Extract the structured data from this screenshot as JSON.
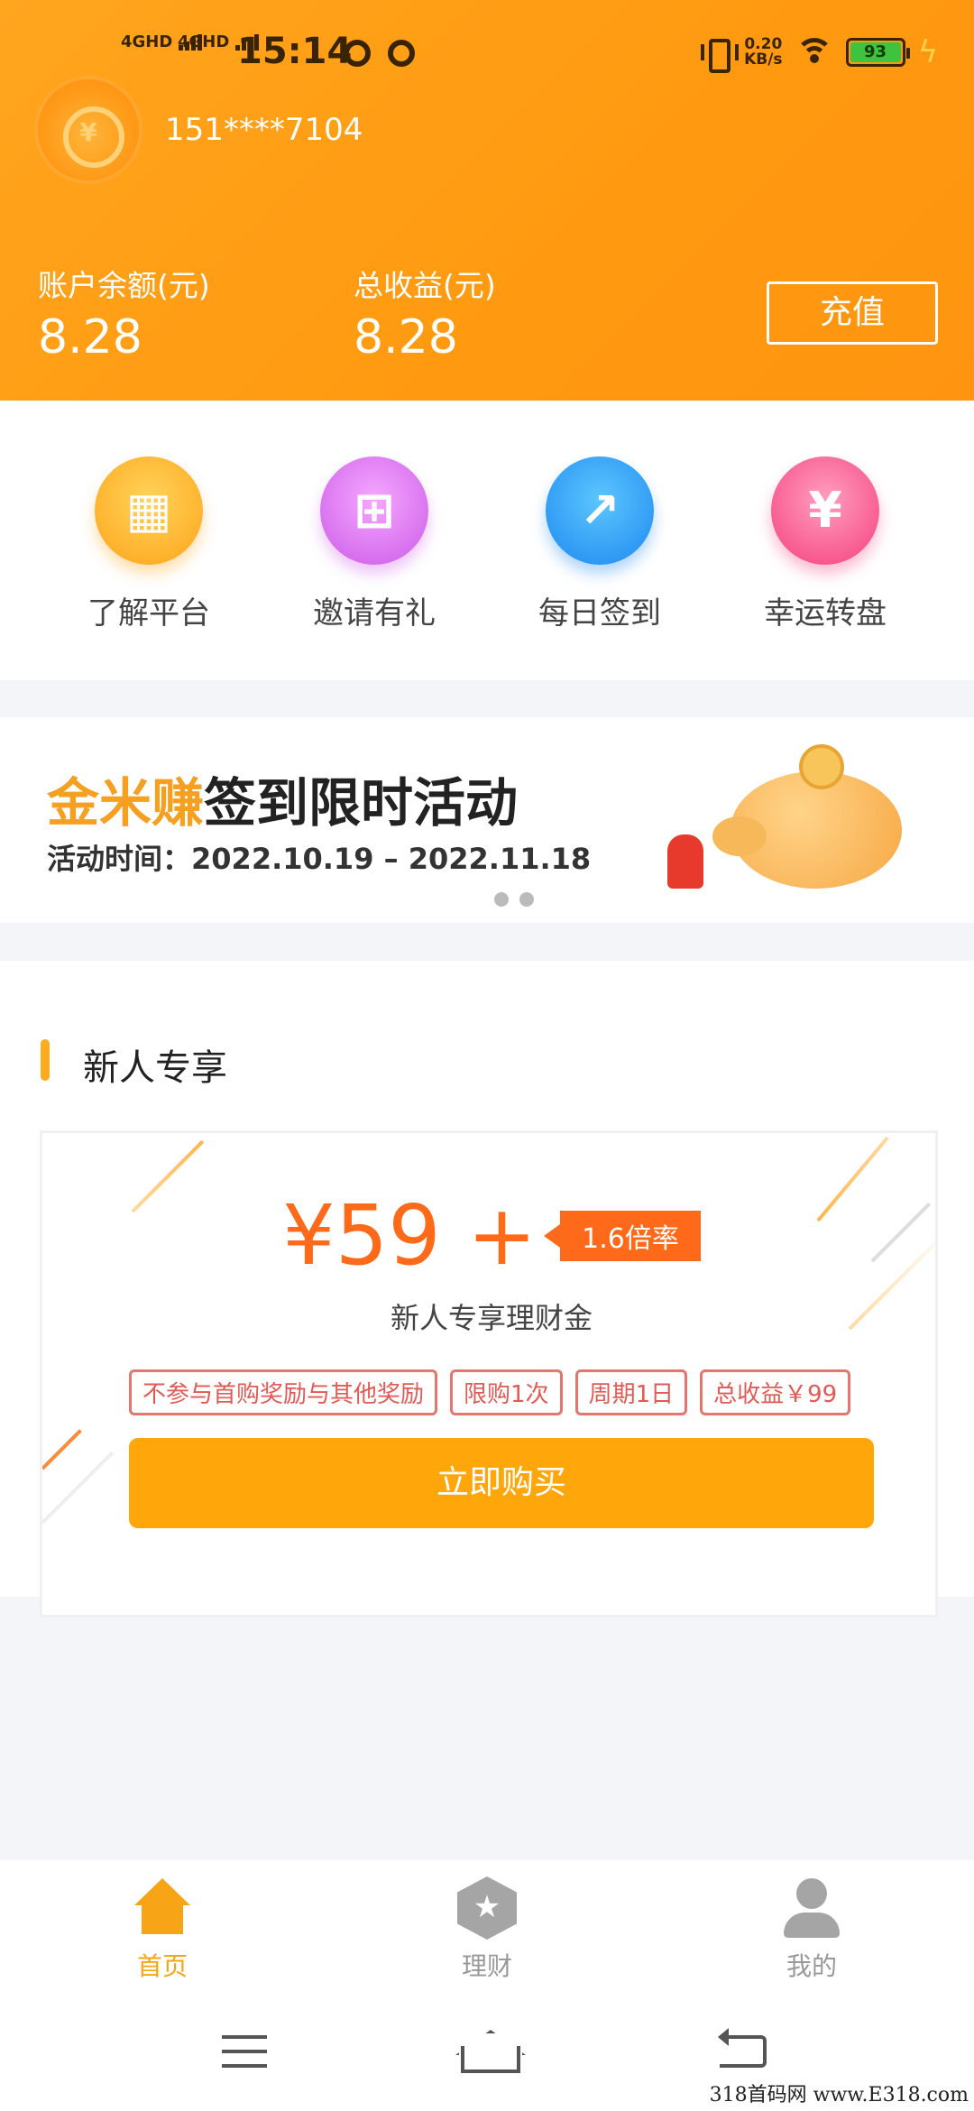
{
  "status_bar": {
    "sim1": "4GHD",
    "sim2": "4GHD",
    "time": "15:14",
    "net_speed_value": "0.20",
    "net_speed_unit": "KB/s",
    "battery": "93"
  },
  "profile": {
    "phone": "151****7104"
  },
  "account": {
    "balance_label": "账户余额(元)",
    "balance_value": "8.28",
    "earnings_label": "总收益(元)",
    "earnings_value": "8.28",
    "recharge_label": "充值"
  },
  "quick_menu": [
    {
      "label": "了解平台",
      "icon": "gold-bars-icon"
    },
    {
      "label": "邀请有礼",
      "icon": "gift-icon"
    },
    {
      "label": "每日签到",
      "icon": "checkin-icon"
    },
    {
      "label": "幸运转盘",
      "icon": "red-envelope-icon"
    }
  ],
  "banner": {
    "title_brand": "金米赚",
    "title_rest": "签到限时活动",
    "time_label": "活动时间：",
    "time_range": "2022.10.19 – 2022.11.18",
    "page_count": 2
  },
  "newbie": {
    "section_title": "新人专享",
    "price": "¥59 +",
    "rate": "1.6倍率",
    "fund_name": "新人专享理财金",
    "tags": [
      "不参与首购奖励与其他奖励",
      "限购1次",
      "周期1日",
      "总收益￥99"
    ],
    "buy_label": "立即购买"
  },
  "tabbar": {
    "home": "首页",
    "finance": "理财",
    "mine": "我的",
    "active": "home"
  },
  "watermark": "318首码网 www.E318.com",
  "colors": {
    "header": "#ff9a10",
    "accent": "#fea60a",
    "price": "#ff6a1a",
    "tag_border": "#e57570"
  }
}
